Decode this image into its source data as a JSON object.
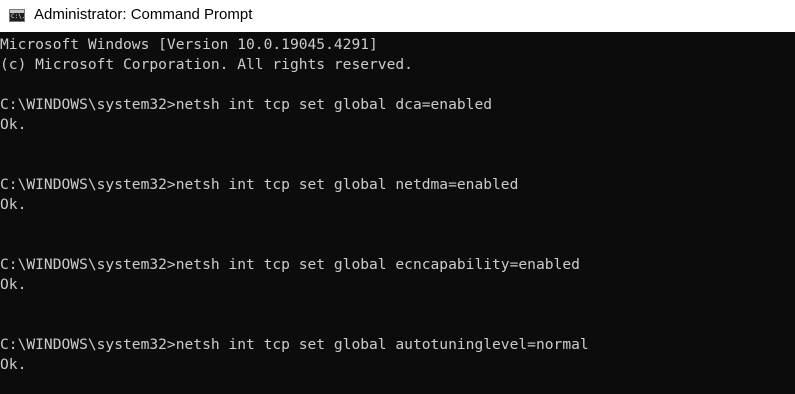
{
  "window": {
    "title": "Administrator: Command Prompt",
    "icon": "command-prompt-icon",
    "icon_text": "C:\\."
  },
  "console": {
    "background": "#0c0c0c",
    "foreground": "#cccccc",
    "lines": [
      "Microsoft Windows [Version 10.0.19045.4291]",
      "(c) Microsoft Corporation. All rights reserved.",
      "",
      "C:\\WINDOWS\\system32>netsh int tcp set global dca=enabled",
      "Ok.",
      "",
      "",
      "C:\\WINDOWS\\system32>netsh int tcp set global netdma=enabled",
      "Ok.",
      "",
      "",
      "C:\\WINDOWS\\system32>netsh int tcp set global ecncapability=enabled",
      "Ok.",
      "",
      "",
      "C:\\WINDOWS\\system32>netsh int tcp set global autotuninglevel=normal",
      "Ok.",
      ""
    ]
  }
}
